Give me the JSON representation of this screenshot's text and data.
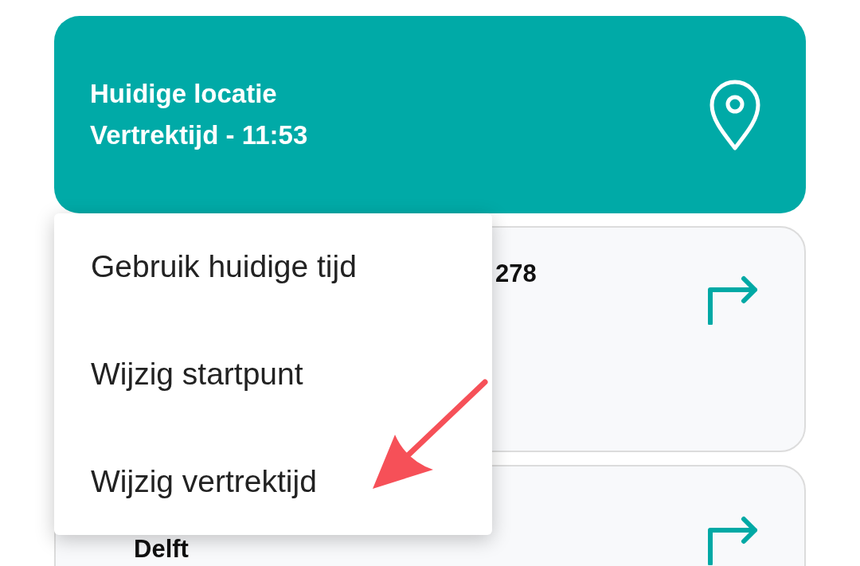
{
  "location_card": {
    "title": "Huidige locatie",
    "subtitle": "Vertrektijd - 11:53"
  },
  "routes": [
    {
      "title": "278"
    },
    {
      "title": "Delft"
    }
  ],
  "menu": {
    "items": [
      {
        "label": "Gebruik huidige tijd"
      },
      {
        "label": "Wijzig startpunt"
      },
      {
        "label": "Wijzig vertrektijd"
      }
    ]
  }
}
